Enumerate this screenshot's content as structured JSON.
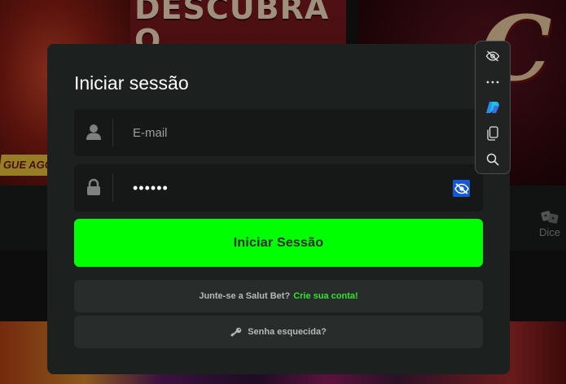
{
  "background": {
    "banner_title": "DESCUBRA O SEGREDO",
    "banner_tagline": "GUE AGO",
    "banner_big_letter": "C",
    "dice_label": "Dice"
  },
  "login": {
    "title": "Iniciar sessão",
    "email_placeholder": "E-mail",
    "password_value": "••••••",
    "submit_label": "Iniciar Sessão",
    "join_text": "Junte-se a Salut Bet?",
    "join_link": "Crie sua conta!",
    "forgot_label": "Senha esquecida?"
  },
  "floating_toolbar": {
    "icons": [
      "eye-slash-icon",
      "more-icon",
      "copilot-icon",
      "copy-icon",
      "search-icon"
    ]
  },
  "colors": {
    "accent_green": "#00ff00",
    "link_green": "#2ee62e",
    "toggle_blue": "#1558d6",
    "modal_bg": "#1c201f"
  }
}
